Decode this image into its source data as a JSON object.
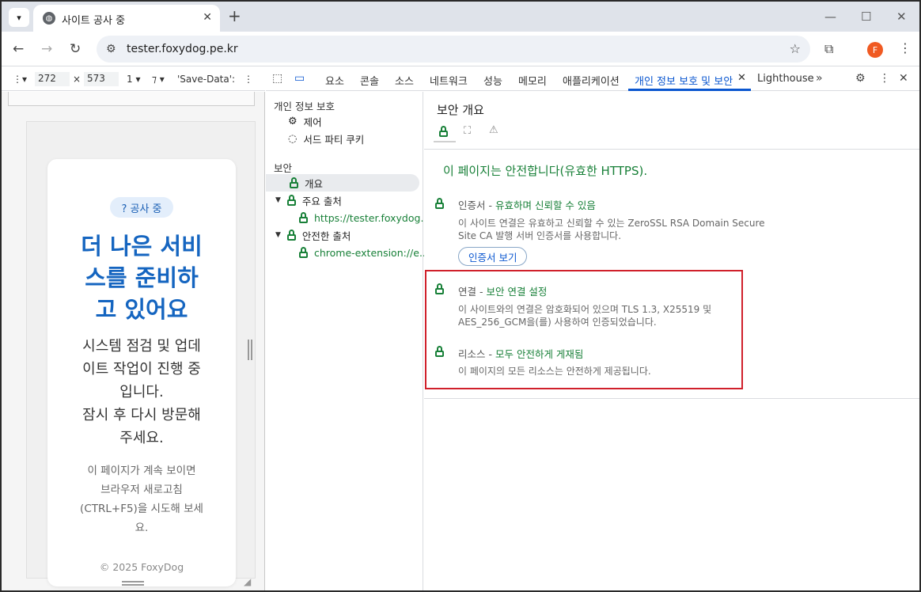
{
  "browser": {
    "tab_title": "사이트 공사 중",
    "url": "tester.foxydog.pe.kr",
    "profile_initial": "F"
  },
  "device_toolbar": {
    "width": "272",
    "height": "573",
    "dpr": "1",
    "network": "'Save-Data': ?"
  },
  "devtools": {
    "tabs": [
      "요소",
      "콘솔",
      "소스",
      "네트워크",
      "성능",
      "메모리",
      "애플리케이션",
      "개인 정보 보호 및 보안",
      "Lighthouse"
    ],
    "active_tab": "개인 정보 보호 및 보안"
  },
  "page": {
    "badge": "? 공사 중",
    "hero_lines": [
      "더 나은 서비",
      "스를 준비하",
      "고 있어요"
    ],
    "desc_lines": [
      "시스템 점검 및 업데",
      "이트 작업이 진행 중",
      "입니다.",
      "잠시 후 다시 방문해",
      "주세요."
    ],
    "hint_lines": [
      "이 페이지가 계속 보이면",
      "브라우저 새로고침",
      "(CTRL+F5)을 시도해 보세",
      "요."
    ],
    "copyright": "© 2025 FoxyDog"
  },
  "sidebar": {
    "privacy_heading": "개인 정보 보호",
    "privacy_items": [
      "제어",
      "서드 파티 쿠키"
    ],
    "security_heading": "보안",
    "overview": "개요",
    "main_origin_label": "주요 출처",
    "main_origin": "https://tester.foxydog...",
    "secure_origin_label": "안전한 출처",
    "secure_origin": "chrome-extension://e..."
  },
  "security": {
    "title": "보안 개요",
    "summary": "이 페이지는 안전합니다(유효한 HTTPS).",
    "certificate": {
      "label": "인증서",
      "status": "유효하며 신뢰할 수 있음",
      "body_lines": [
        "이 사이트 연결은 유효하고 신뢰할 수 있는 ZeroSSL RSA Domain Secure",
        "Site CA 발행 서버 인증서를 사용합니다."
      ],
      "button": "인증서 보기"
    },
    "connection": {
      "label": "연결",
      "status": "보안 연결 설정",
      "body_lines": [
        "이 사이트와의 연결은 암호화되어 있으며 TLS 1.3, X25519 및",
        "AES_256_GCM을(를) 사용하여 인증되었습니다."
      ]
    },
    "resources": {
      "label": "리소스",
      "status": "모두 안전하게 게재됨",
      "body": "이 페이지의 모든 리소스는 안전하게 제공됩니다."
    },
    "accent_color": "#188038",
    "highlight_color": "#d0202b"
  }
}
